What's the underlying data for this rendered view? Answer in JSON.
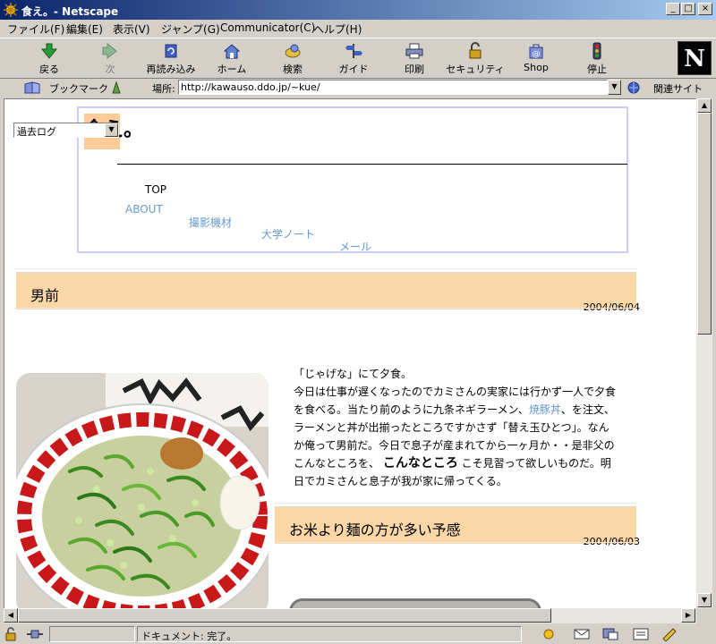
{
  "window": {
    "title": "食え。- Netscape",
    "buttons": [
      "minimize",
      "maximize",
      "close"
    ]
  },
  "menubar": {
    "items": [
      "ファイル(F)",
      "編集(E)",
      "表示(V)",
      "ジャンプ(G)",
      "Communicator(C)",
      "ヘルプ(H)"
    ]
  },
  "toolbar": {
    "back": "戻る",
    "forward": "次",
    "reload": "再読み込み",
    "home": "ホーム",
    "search": "検索",
    "guide": "ガイド",
    "print": "印刷",
    "security": "セキュリティ",
    "shop": "Shop",
    "stop": "停止",
    "logo": "N"
  },
  "locationbar": {
    "bookmarks": "ブックマーク",
    "location_label": "場所:",
    "url": "http://kawauso.ddo.jp/~kue/",
    "related": "関連サイト"
  },
  "page": {
    "archive_select": "過去ログ",
    "logo_text": "食え。",
    "nav": {
      "top": "TOP",
      "about": "ABOUT",
      "equipment": "撮影機材",
      "notes": "大学ノート",
      "mail": "メール"
    },
    "posts": [
      {
        "title": "男前",
        "date": "2004/06/04",
        "p1": "「じゃげな」にて夕食。",
        "p2a": "今日は仕事が遅くなったのでカミさんの実家には行かず一人で夕食を食べる。当たり前のように九条ネギラーメン、",
        "link": "焼豚丼",
        "p2b": "、を注文、ラーメンと丼が出揃ったところですかさず「替え玉ひとつ」。なんか俺って男前だ。今日で息子が産まれてから一ヶ月か・・是非父のこんなところを、",
        "bold": "こんなところ",
        "p2c": "こそ見習って欲しいものだ。明日でカミさんと息子が我が家に帰ってくる。"
      },
      {
        "title": "お米より麺の方が多い予感",
        "date": "2004/06/03"
      }
    ]
  },
  "statusbar": {
    "text": "ドキュメント: 完了。"
  },
  "colors": {
    "post_header_bg": "#fad7a6",
    "link": "#6699cc",
    "header_border": "#ccccff"
  }
}
